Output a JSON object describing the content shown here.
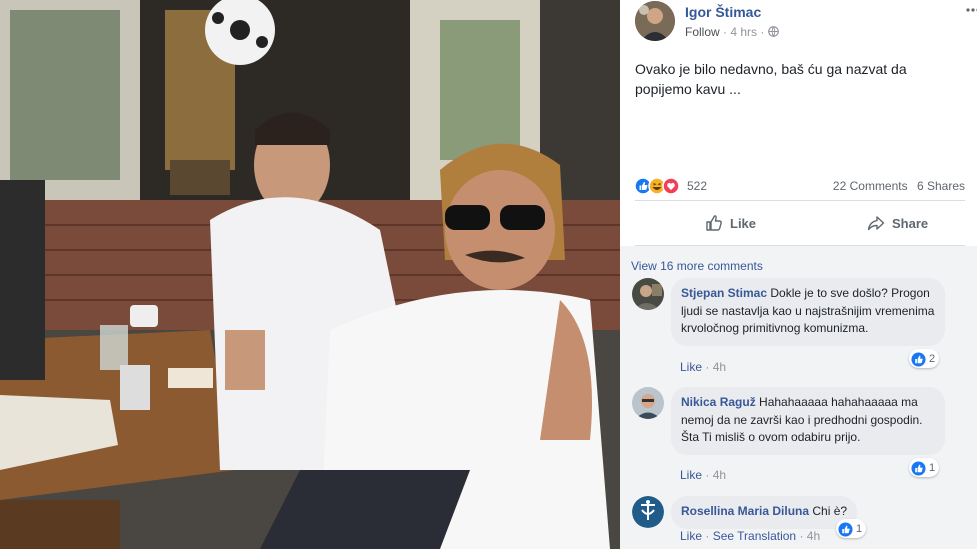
{
  "post": {
    "author": "Igor Štimac",
    "follow": "Follow",
    "separator": "·",
    "time": "4 hrs",
    "separator2": "·",
    "text": "Ovako je bilo nedavno, baš ću ga nazvat da popijemo kavu ...",
    "more_icon": "more-options-icon",
    "privacy_icon": "globe-icon"
  },
  "stats": {
    "reactions": "522",
    "comments": "22 Comments",
    "shares": "6 Shares"
  },
  "actions": {
    "like": "Like",
    "share": "Share"
  },
  "comments_section": {
    "view_more": "View 16 more comments",
    "items": [
      {
        "name": "Stjepan Stimac",
        "text": "Dokle je to sve došlo? Progon ljudi se nastavlja kao u najstrašnijim vremenima krvoločnog primitivnog komunizma.",
        "reactions": "2",
        "like": "Like",
        "dot": "·",
        "time": "4h"
      },
      {
        "name": "Nikica Raguž",
        "text": "Hahahaaaaa hahahaaaaa ma nemoj da ne završi kao i predhodni gospodin. Šta Ti misliš o ovom odabiru prijo.",
        "reactions": "1",
        "like": "Like",
        "dot": "·",
        "time": "4h"
      },
      {
        "name": "Rosellina Maria Diluna",
        "text": "Chi è?",
        "reactions": "1",
        "like": "Like",
        "dot": "·",
        "see_translation": "See Translation",
        "dot2": "·",
        "time": "4h"
      }
    ]
  },
  "colors": {
    "link": "#385898",
    "author": "#365899",
    "like_blue": "#1877f2",
    "love_red": "#f33e58",
    "haha_yellow": "#f7b125",
    "comment_bg": "#f2f3f5",
    "bubble_bg": "#e9ebee"
  }
}
